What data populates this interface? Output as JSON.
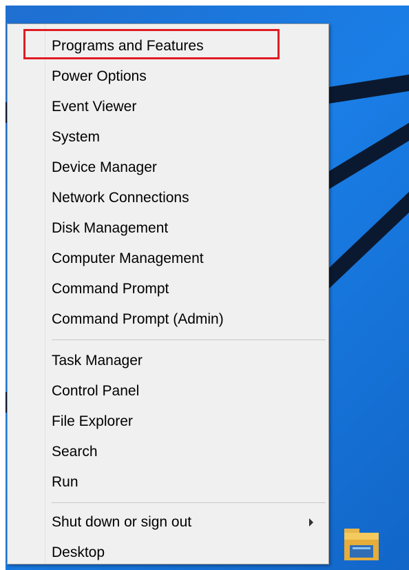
{
  "menu": {
    "groups": [
      {
        "items": [
          {
            "label": "Programs and Features",
            "highlighted": true
          },
          {
            "label": "Power Options"
          },
          {
            "label": "Event Viewer"
          },
          {
            "label": "System"
          },
          {
            "label": "Device Manager"
          },
          {
            "label": "Network Connections"
          },
          {
            "label": "Disk Management"
          },
          {
            "label": "Computer Management"
          },
          {
            "label": "Command Prompt"
          },
          {
            "label": "Command Prompt (Admin)"
          }
        ]
      },
      {
        "items": [
          {
            "label": "Task Manager"
          },
          {
            "label": "Control Panel"
          },
          {
            "label": "File Explorer"
          },
          {
            "label": "Search"
          },
          {
            "label": "Run"
          }
        ]
      },
      {
        "items": [
          {
            "label": "Shut down or sign out",
            "has_submenu": true
          },
          {
            "label": "Desktop"
          }
        ]
      }
    ]
  },
  "colors": {
    "highlight_border": "#e01b24",
    "menu_background": "#f0f0f0",
    "desktop_background": "#1a7ee6"
  },
  "icons": {
    "submenu_arrow": "chevron-right-icon",
    "taskbar_folder": "file-explorer-folder-icon"
  }
}
